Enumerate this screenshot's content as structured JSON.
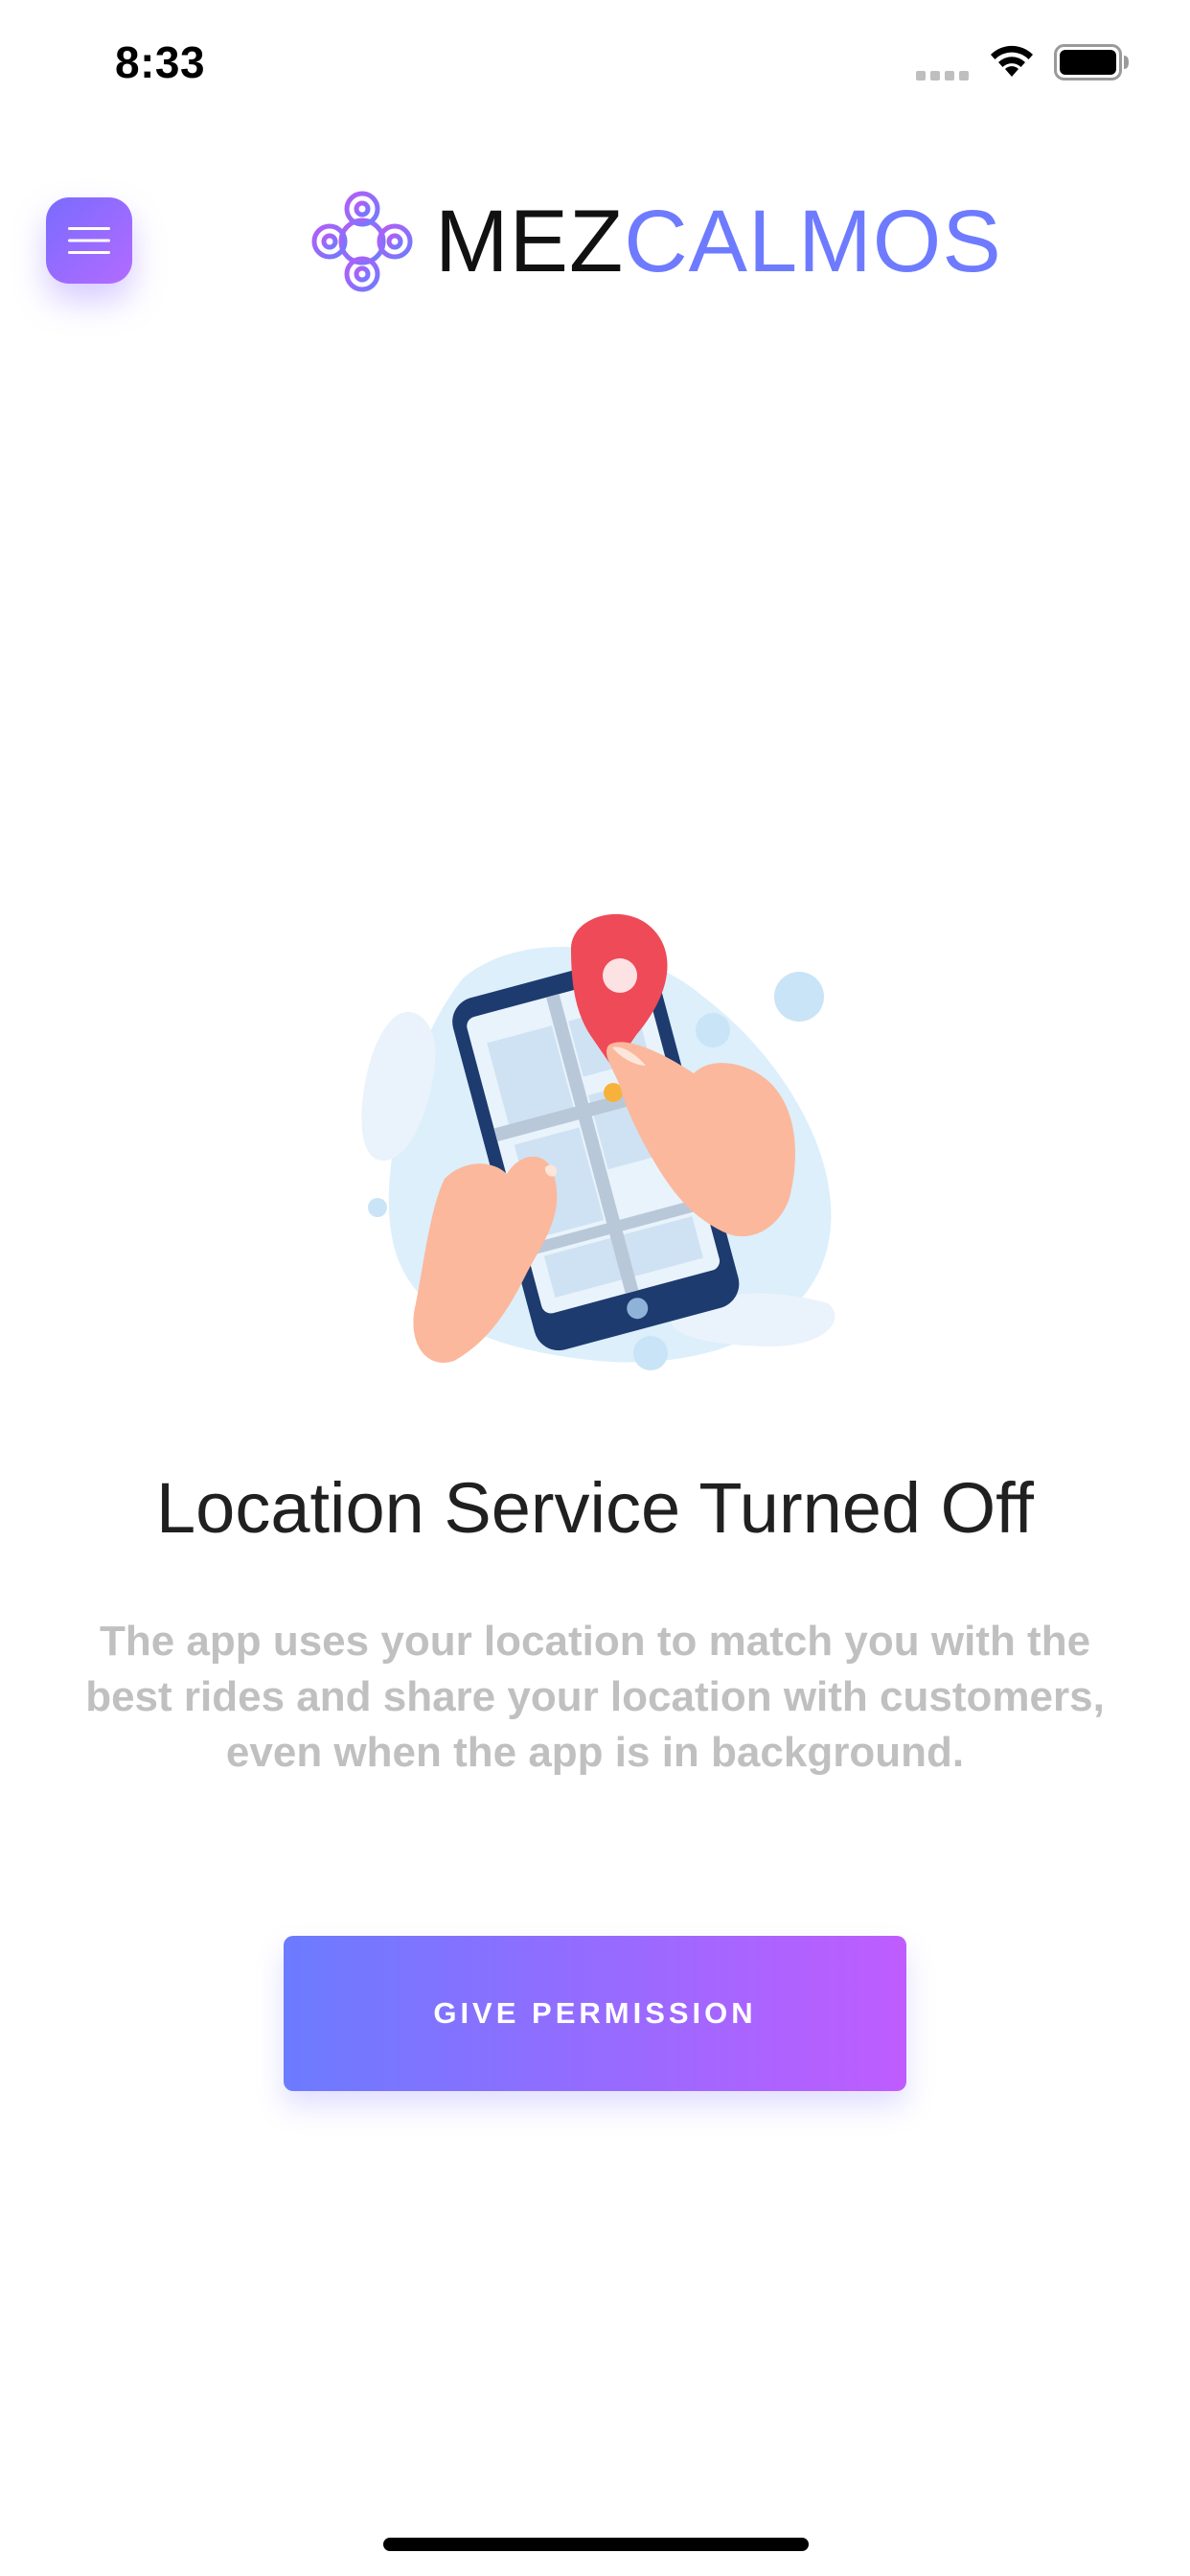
{
  "status_bar": {
    "time": "8:33",
    "icons": [
      "signal-dots-icon",
      "wifi-icon",
      "battery-icon"
    ]
  },
  "header": {
    "menu_icon": "hamburger-menu-icon",
    "logo_icon": "mezcalmos-logo-icon",
    "brand_part_1": "MEZ",
    "brand_part_2": "CALMOS"
  },
  "illustration": {
    "icon": "phone-location-pin-illustration"
  },
  "content": {
    "title": "Location Service Turned Off",
    "description": "The app uses your location to match you with the best rides and share your location with customers, even when the app is in background.",
    "button_label": "GIVE PERMISSION"
  },
  "colors": {
    "accent_blue": "#6e7bff",
    "accent_purple": "#bf5cff",
    "pin_red": "#ef4a57",
    "text_dark": "#202020",
    "text_muted": "#c0c0c0"
  }
}
